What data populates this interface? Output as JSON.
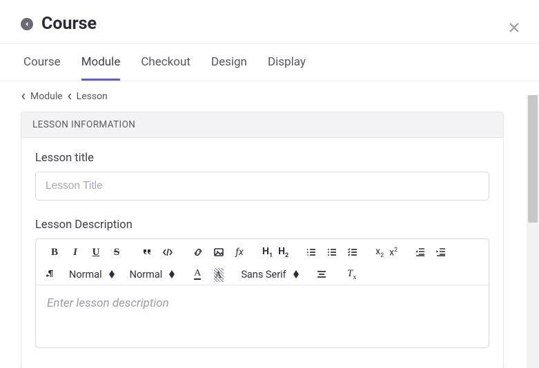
{
  "header": {
    "title": "Course"
  },
  "tabs": [
    {
      "label": "Course",
      "active": false
    },
    {
      "label": "Module",
      "active": true
    },
    {
      "label": "Checkout",
      "active": false
    },
    {
      "label": "Design",
      "active": false
    },
    {
      "label": "Display",
      "active": false
    }
  ],
  "breadcrumb": {
    "module": "Module",
    "lesson": "Lesson"
  },
  "panel": {
    "heading": "LESSON INFORMATION",
    "title_label": "Lesson title",
    "title_placeholder": "Lesson Title",
    "title_value": "",
    "desc_label": "Lesson Description",
    "desc_placeholder": "Enter lesson description"
  },
  "toolbar": {
    "size_select": "Normal",
    "header_select": "Normal",
    "font_select": "Sans Serif",
    "h1": "H",
    "h1sub": "1",
    "h2": "H",
    "h2sub": "2",
    "x2sub": "2",
    "x2sup": "2",
    "fx": "ƒx",
    "tx": "T",
    "txsub": "x",
    "colorA": "A",
    "bgA": "A"
  }
}
